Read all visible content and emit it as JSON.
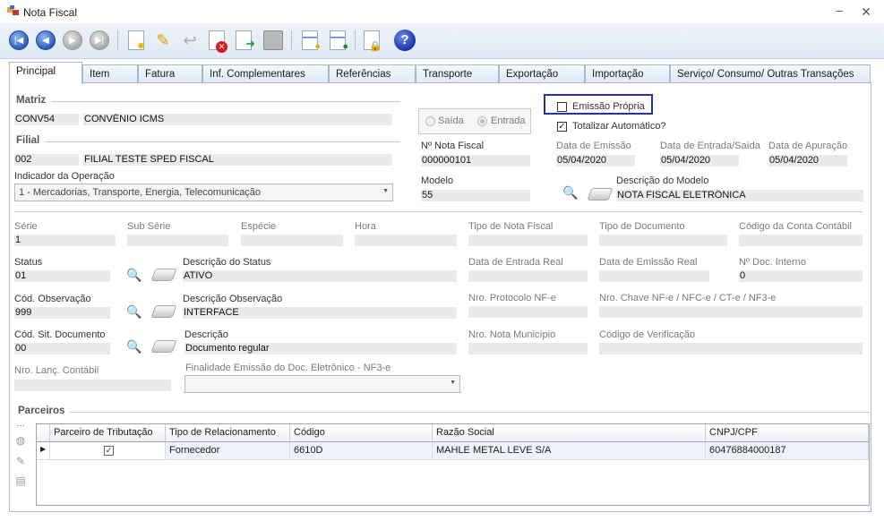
{
  "window": {
    "title": "Nota Fiscal"
  },
  "tabs": [
    "Principal",
    "Item",
    "Fatura",
    "Inf. Complementares",
    "Referências",
    "Transporte",
    "Exportação",
    "Importação",
    "Serviço/ Consumo/ Outras Transações"
  ],
  "matriz": {
    "section": "Matriz",
    "code": "CONV54",
    "name": "CONVÊNIO ICMS"
  },
  "filial": {
    "section": "Filial",
    "code": "002",
    "name": "FILIAL TESTE SPED FISCAL"
  },
  "indicador": {
    "label": "Indicador da Operação",
    "value": "1 - Mercadorias, Transporte, Energia, Telecomunicação"
  },
  "radio": {
    "saida": "Saída",
    "entrada": "Entrada"
  },
  "checks": {
    "emissao_propria": "Emissão Própria",
    "totalizar": "Totalizar Automático?"
  },
  "nota": {
    "label": "Nº Nota Fiscal",
    "value": "000000101"
  },
  "dates": {
    "emissao_label": "Data de Emissão",
    "emissao": "05/04/2020",
    "entrada_label": "Data de Entrada/Saída",
    "entrada": "05/04/2020",
    "apuracao_label": "Data de Apuração",
    "apuracao": "05/04/2020"
  },
  "modelo": {
    "label": "Modelo",
    "value": "55",
    "desc_label": "Descrição do Modelo",
    "desc": "NOTA FISCAL ELETRÔNICA"
  },
  "row1": {
    "serie_label": "Série",
    "serie": "1",
    "subserie_label": "Sub Série",
    "especie_label": "Espécie",
    "hora_label": "Hora",
    "tiponf_label": "Tipo de Nota Fiscal",
    "tipodoc_label": "Tipo de Documento",
    "conta_label": "Código da Conta Contábil"
  },
  "status": {
    "label": "Status",
    "value": "01",
    "desc_label": "Descrição do Status",
    "desc": "ATIVO",
    "entrada_real_label": "Data de Entrada Real",
    "emissao_real_label": "Data de Emissão Real",
    "doc_interno_label": "Nº Doc. Interno",
    "doc_interno": "0"
  },
  "obs": {
    "label": "Cód. Observação",
    "value": "999",
    "desc_label": "Descrição Observação",
    "desc": "INTERFACE",
    "protocolo_label": "Nro. Protocolo NF-e",
    "chave_label": "Nro. Chave NF-e / NFC-e / CT-e / NF3-e"
  },
  "sit": {
    "label": "Cód. Sit. Documento",
    "value": "00",
    "desc_label": "Descrição",
    "desc": "Documento regular",
    "municipio_label": "Nro. Nota Município",
    "verificacao_label": "Código de Verificação"
  },
  "lanc": {
    "label": "Nro. Lanç. Contábil",
    "finalidade_label": "Finalidade Emissão do Doc. Eletrônico - NF3-e"
  },
  "parceiros": {
    "section": "Parceiros",
    "columns": [
      "Parceiro de Tributação",
      "Tipo de Relacionamento",
      "Código",
      "Razão Social",
      "CNPJ/CPF"
    ],
    "rows": [
      {
        "tipo": "Fornecedor",
        "codigo": "6610D",
        "razao": "MAHLE METAL LEVE S/A",
        "cnpj": "60476884000187"
      }
    ]
  }
}
